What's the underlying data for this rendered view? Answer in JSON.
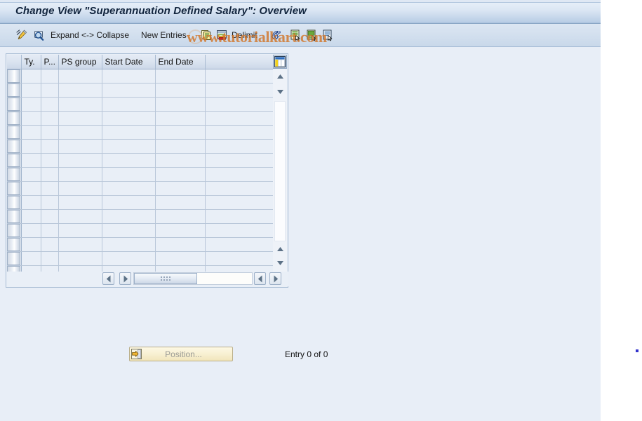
{
  "window": {
    "title": "Change View \"Superannuation Defined Salary\": Overview"
  },
  "toolbar": {
    "items": [
      {
        "name": "change-display-toggle",
        "icon": "pencil-icon",
        "label": ""
      },
      {
        "name": "display-detail",
        "icon": "magnifier-display-icon",
        "label": ""
      },
      {
        "name": "expand-collapse",
        "icon": "",
        "label": "Expand <-> Collapse"
      },
      {
        "name": "new-entries",
        "icon": "",
        "label": "New Entries"
      },
      {
        "name": "copy-as",
        "icon": "copy-icon",
        "label": ""
      },
      {
        "name": "delete-row",
        "icon": "delete-row-icon",
        "label": ""
      },
      {
        "name": "delimit",
        "icon": "",
        "label": "Delimit"
      },
      {
        "name": "undo-change",
        "icon": "undo-arrows-icon",
        "label": ""
      },
      {
        "name": "previous-entry",
        "icon": "document-select-green-icon",
        "label": ""
      },
      {
        "name": "next-entry",
        "icon": "document-select-green2-icon",
        "label": ""
      },
      {
        "name": "entry-details",
        "icon": "document-select-blue-icon",
        "label": ""
      }
    ]
  },
  "watermark": {
    "text": "www.tutorialkart.com"
  },
  "table": {
    "columns": [
      {
        "key": "select",
        "label": ""
      },
      {
        "key": "type",
        "label": "Ty."
      },
      {
        "key": "p",
        "label": "P..."
      },
      {
        "key": "ps_group",
        "label": "PS group"
      },
      {
        "key": "start_date",
        "label": "Start Date"
      },
      {
        "key": "end_date",
        "label": "End Date"
      }
    ],
    "rows": [],
    "empty_row_count": 15,
    "column_config_icon": "table-settings-icon"
  },
  "scrollbars": {
    "vertical": {
      "up_icon": "triangle-up-icon",
      "down_icon": "triangle-down-icon"
    },
    "horizontal": {
      "left_icon": "triangle-left-icon",
      "right_icon": "triangle-right-icon"
    }
  },
  "footer": {
    "position_button": {
      "label": "Position...",
      "icon": "position-goto-icon",
      "enabled": false
    },
    "entry_status": "Entry 0 of 0"
  },
  "colors": {
    "app_background": "#e8eef7",
    "title_bar_start": "#eaf1fa",
    "title_bar_end": "#9fb8d6",
    "toolbar_background": "#d2dfee",
    "grid_cell": "#e9eff7",
    "grid_border": "#b9c7d9",
    "header_border": "#9fb3cc",
    "watermark": "#d2762a",
    "position_button_face": "#f8f0d2",
    "position_button_border": "#b9ae8a",
    "disabled_text": "#9a9a94"
  }
}
